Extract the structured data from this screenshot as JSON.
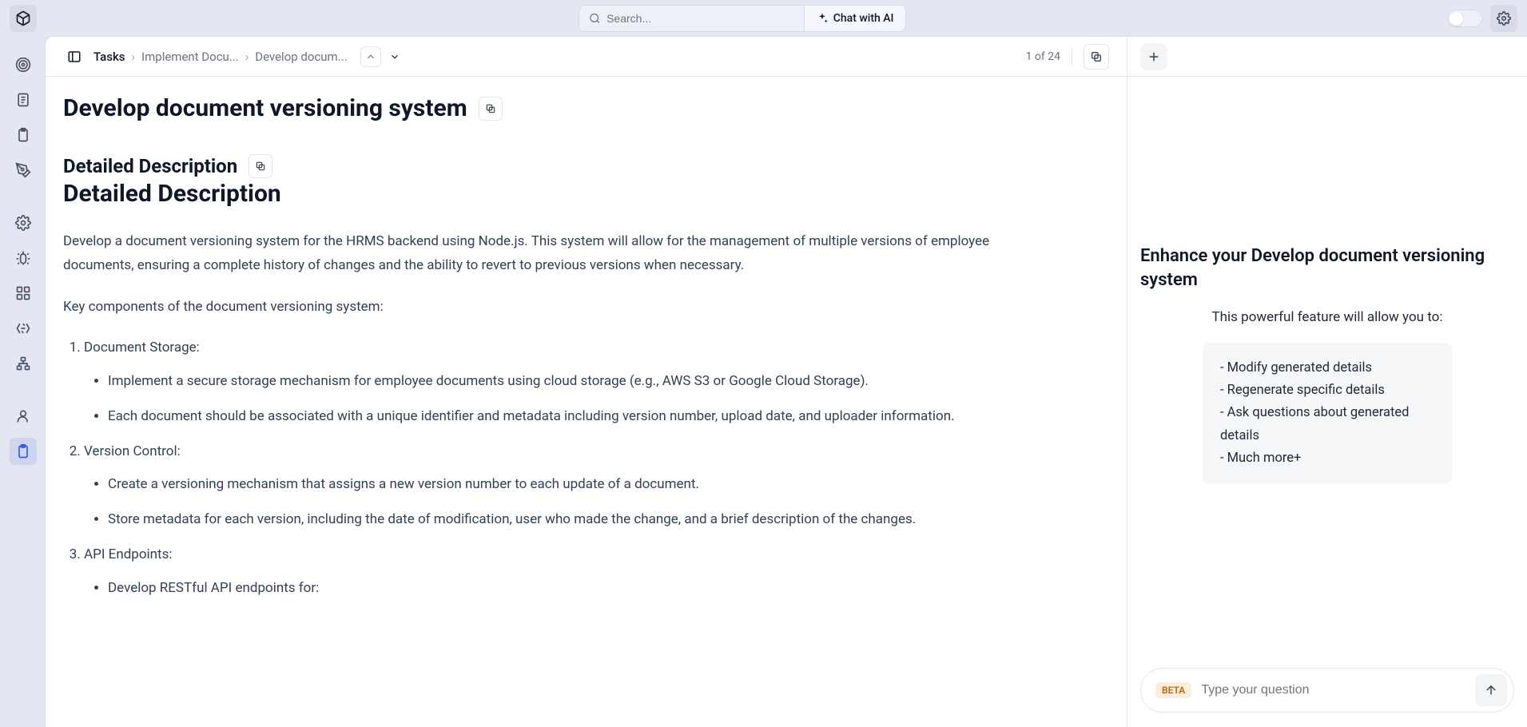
{
  "topbar": {
    "search_placeholder": "Search...",
    "chat_label": "Chat with AI"
  },
  "breadcrumb": {
    "root": "Tasks",
    "mid": "Implement Docu...",
    "leaf": "Develop docum..."
  },
  "pager": {
    "text": "1 of 24"
  },
  "page": {
    "title": "Develop document versioning system",
    "section_label": "Detailed Description",
    "section_heading": "Detailed Description",
    "intro": "Develop a document versioning system for the HRMS backend using Node.js. This system will allow for the management of multiple versions of employee documents, ensuring a complete history of changes and the ability to revert to previous versions when necessary.",
    "lead_in": "Key components of the document versioning system:",
    "items": [
      {
        "title": "Document Storage:",
        "bullets": [
          "Implement a secure storage mechanism for employee documents using cloud storage (e.g., AWS S3 or Google Cloud Storage).",
          "Each document should be associated with a unique identifier and metadata including version number, upload date, and uploader information."
        ]
      },
      {
        "title": "Version Control:",
        "bullets": [
          "Create a versioning mechanism that assigns a new version number to each update of a document.",
          "Store metadata for each version, including the date of modification, user who made the change, and a brief description of the changes."
        ]
      },
      {
        "title": "API Endpoints:",
        "bullets": [
          "Develop RESTful API endpoints for:"
        ]
      }
    ]
  },
  "right": {
    "title": "Enhance your Develop document versioning system",
    "subtitle": "This powerful feature will allow you to:",
    "points": [
      "- Modify generated details",
      "- Regenerate specific details",
      "- Ask questions about generated details",
      "- Much more+"
    ],
    "beta": "BETA",
    "placeholder": "Type your question"
  }
}
